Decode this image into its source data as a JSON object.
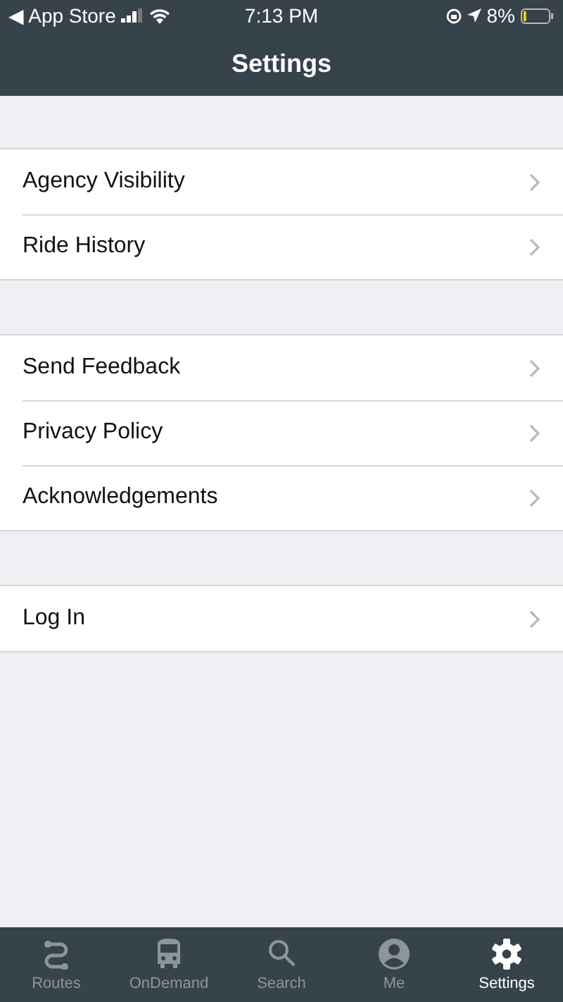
{
  "status_bar": {
    "back_label": "◀ App Store",
    "time": "7:13 PM",
    "battery_text": "8%"
  },
  "title": "Settings",
  "sections": [
    {
      "rows": [
        {
          "label": "Agency Visibility"
        },
        {
          "label": "Ride History"
        }
      ]
    },
    {
      "rows": [
        {
          "label": "Send Feedback"
        },
        {
          "label": "Privacy Policy"
        },
        {
          "label": "Acknowledgements"
        }
      ]
    },
    {
      "rows": [
        {
          "label": "Log In"
        }
      ]
    }
  ],
  "tabs": [
    {
      "label": "Routes",
      "kind": "routes",
      "selected": false
    },
    {
      "label": "OnDemand",
      "kind": "bus",
      "selected": false
    },
    {
      "label": "Search",
      "kind": "search",
      "selected": false
    },
    {
      "label": "Me",
      "kind": "person",
      "selected": false
    },
    {
      "label": "Settings",
      "kind": "gear",
      "selected": true
    }
  ]
}
